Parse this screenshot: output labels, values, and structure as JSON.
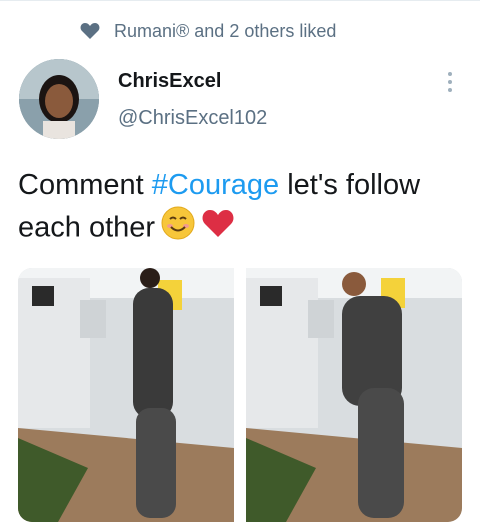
{
  "social_context": {
    "text": "Rumani® and 2 others liked",
    "icon": "heart-icon"
  },
  "author": {
    "display_name": "ChrisExcel",
    "handle": "@ChrisExcel102",
    "avatar": "avatar"
  },
  "more_menu": {
    "icon": "more-vertical-icon"
  },
  "tweet": {
    "text_before": "Comment ",
    "hashtag": "#Courage",
    "text_after": " let's follow each other",
    "emojis": [
      "smiling-face-emoji",
      "red-heart-emoji"
    ]
  },
  "media": [
    {
      "name": "tweet-photo-1"
    },
    {
      "name": "tweet-photo-2"
    }
  ],
  "colors": {
    "link": "#1d9bf0",
    "secondary_text": "#5b7083",
    "primary_text": "#14171a"
  }
}
